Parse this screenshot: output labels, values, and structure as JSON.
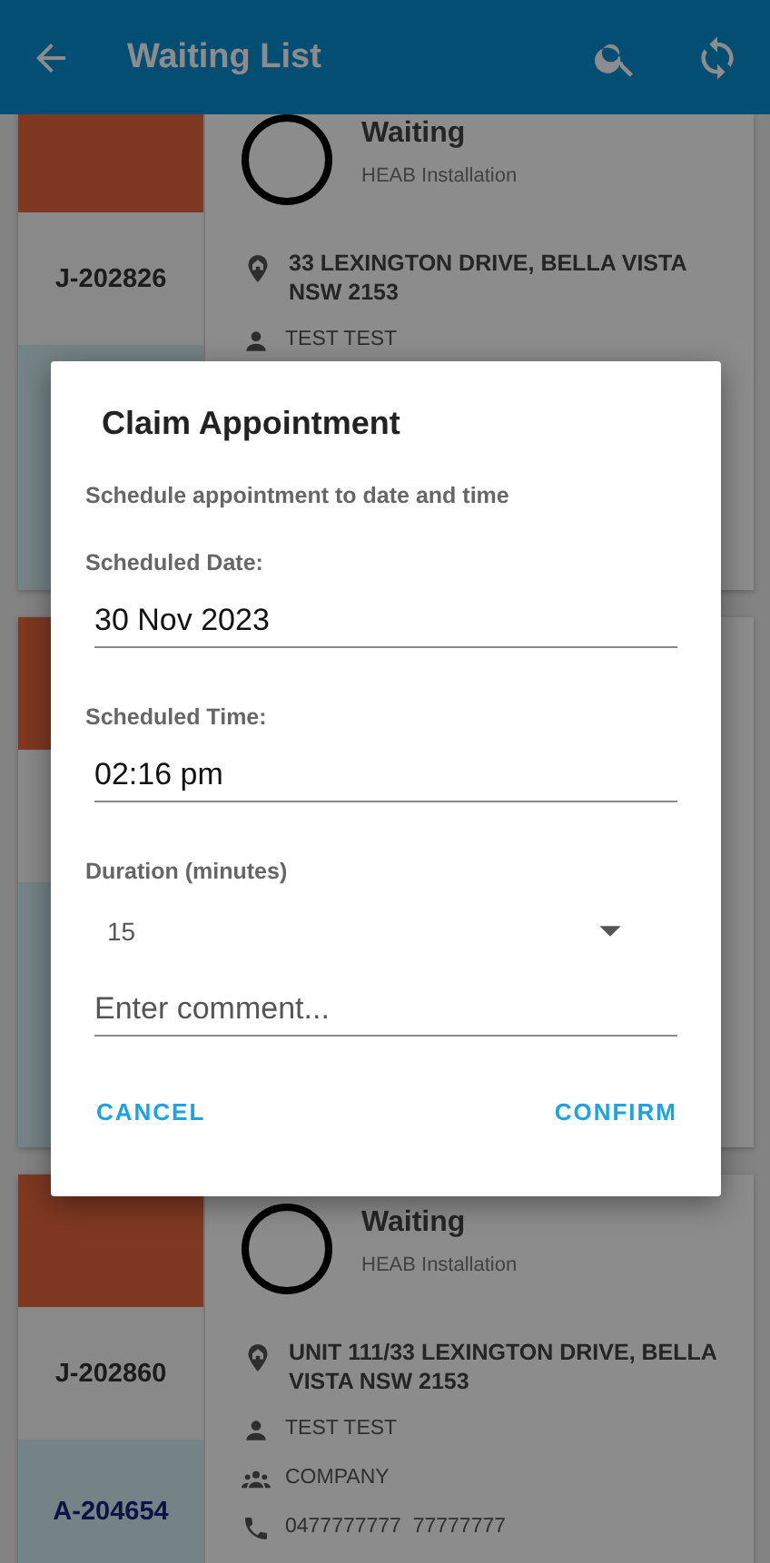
{
  "app_bar": {
    "title": "Waiting List"
  },
  "cards": [
    {
      "kind": "job",
      "status": "Waiting",
      "job_type": "HEAB Installation",
      "job_id": "J-202826",
      "address": "33 LEXINGTON DRIVE, BELLA VISTA NSW 2153",
      "contacts": [
        {
          "kind": "person",
          "text": "TEST TEST"
        }
      ]
    },
    {
      "kind": "covered"
    },
    {
      "kind": "job",
      "status": "Waiting",
      "job_type": "HEAB Installation",
      "job_id": "J-202860",
      "appointment_id": "A-204654",
      "address": "UNIT 111/33 LEXINGTON DRIVE, BELLA VISTA NSW 2153",
      "contacts": [
        {
          "kind": "person",
          "text": "TEST TEST"
        },
        {
          "kind": "company",
          "text": "COMPANY"
        },
        {
          "kind": "phone",
          "text": "0477777777  77777777"
        }
      ]
    }
  ],
  "dialog": {
    "title": "Claim Appointment",
    "subtitle": "Schedule appointment to date and time",
    "fields": [
      {
        "kind": "text",
        "label": "Scheduled Date:",
        "value": "30 Nov 2023"
      },
      {
        "kind": "text",
        "label": "Scheduled Time:",
        "value": "02:16 pm"
      },
      {
        "kind": "select",
        "label": "Duration (minutes)",
        "value": "15"
      },
      {
        "kind": "comment",
        "placeholder": "Enter comment..."
      }
    ],
    "buttons": [
      "CANCEL",
      "CONFIRM"
    ]
  }
}
